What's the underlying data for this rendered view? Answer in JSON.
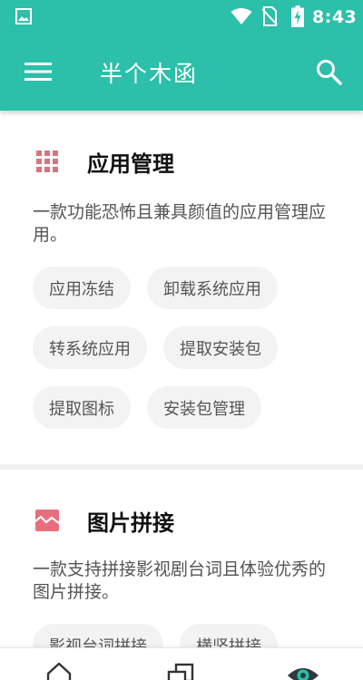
{
  "status_bar": {
    "time": "8:43",
    "icons": [
      "image-notification-icon",
      "wifi-icon",
      "no-sim-icon",
      "battery-charging-icon"
    ]
  },
  "app_bar": {
    "title": "半个木函",
    "icons": [
      "menu-icon",
      "search-icon"
    ]
  },
  "sections": [
    {
      "title": "应用管理",
      "icon": "grid-icon",
      "icon_color": "#d9727e",
      "description": "一款功能恐怖且兼具颜值的应用管理应用。",
      "chips": [
        [
          "应用冻结",
          "卸载系统应用"
        ],
        [
          "转系统应用",
          "提取安装包"
        ],
        [
          "提取图标",
          "安装包管理"
        ]
      ]
    },
    {
      "title": "图片拼接",
      "icon": "image-stitch-icon",
      "icon_color": "#e86e7e",
      "description": "一款支持拼接影视剧台词且体验优秀的图片拼接。",
      "chips": [
        [
          "影视台词拼接",
          "横竖拼接"
        ]
      ]
    }
  ],
  "bottom_nav": {
    "items": [
      "home-icon",
      "layers-icon",
      "eye-icon"
    ]
  },
  "colors": {
    "primary": "#2cbfa9",
    "chip_bg": "#f3f3f3",
    "text_secondary": "#555555"
  }
}
